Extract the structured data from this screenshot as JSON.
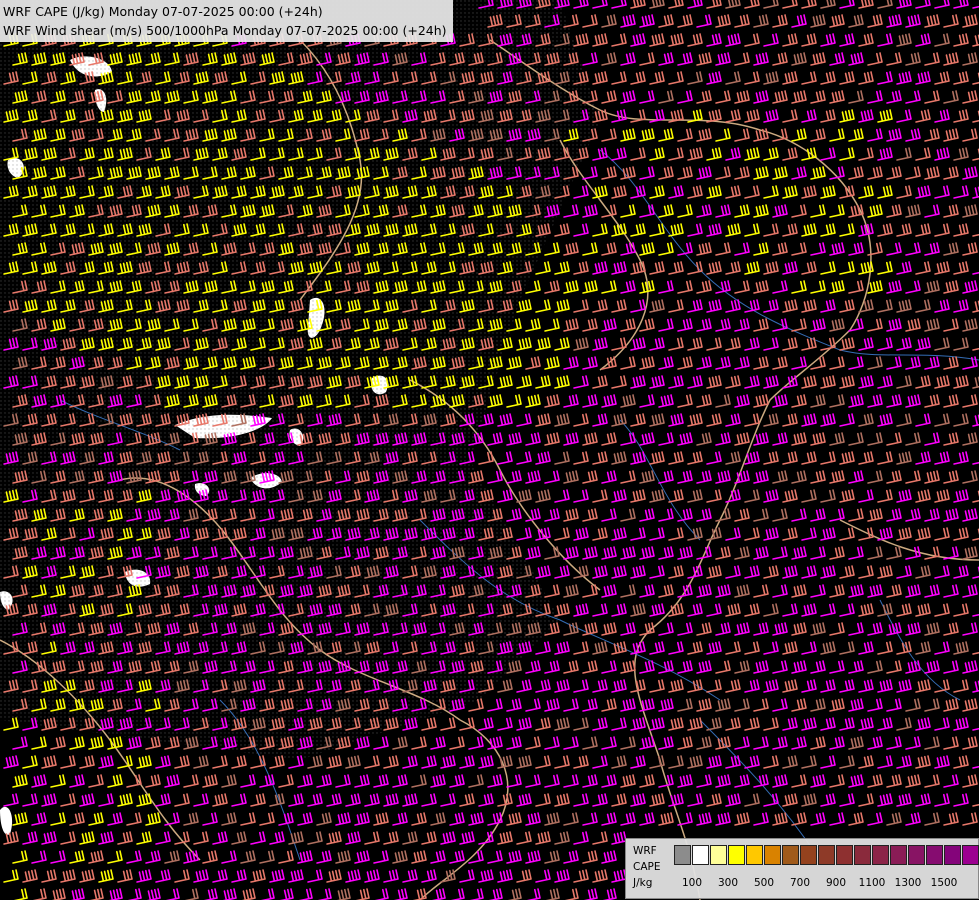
{
  "titles": {
    "line1": "WRF CAPE (J/kg) Monday 07-07-2025 00:00 (+24h)",
    "line2": "WRF Wind shear (m/s) 500/1000hPa Monday 07-07-2025 00:00 (+24h)"
  },
  "legend": {
    "line1": "WRF",
    "line2": "CAPE",
    "line3": "J/kg",
    "colors": [
      "#8c8c8c",
      "#ffffff",
      "#ffff99",
      "#ffff00",
      "#ffc800",
      "#d98200",
      "#a05a1a",
      "#94421e",
      "#8e3a28",
      "#8e3030",
      "#8a2a3c",
      "#8c2448",
      "#8a1c56",
      "#881464",
      "#860c70",
      "#84047a",
      "#9c0090"
    ],
    "tick_labels": [
      "100",
      "300",
      "500",
      "700",
      "900",
      "1100",
      "1300",
      "1500"
    ]
  },
  "colors": {
    "barb_yellow": "#ffff00",
    "barb_salmon": "#e8786a",
    "barb_magenta": "#ff00ff",
    "barb_brown": "#b07060",
    "border": "#f0c896",
    "river": "#3a78c8",
    "cape_white": "#ffffff"
  }
}
